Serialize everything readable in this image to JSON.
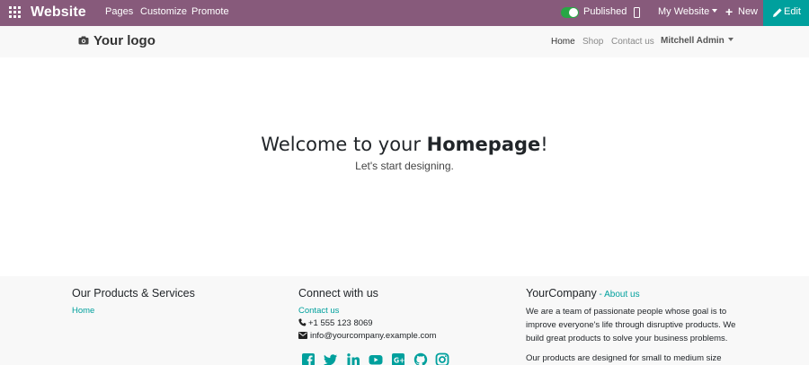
{
  "admin_bar": {
    "app_name": "Website",
    "menus": [
      "Pages",
      "Customize",
      "Promote"
    ],
    "published_label": "Published",
    "website_selector": "My Website",
    "new_label": "New",
    "edit_label": "Edit",
    "colors": {
      "bar": "#875a7b",
      "edit": "#00a09d",
      "toggle_on": "#28a745"
    }
  },
  "site_header": {
    "logo_text": "Your logo",
    "nav": [
      "Home",
      "Shop",
      "Contact us"
    ],
    "user": "Mitchell Admin"
  },
  "hero": {
    "title_prefix": "Welcome to your ",
    "title_bold": "Homepage",
    "title_suffix": "!",
    "subtitle": "Let's start designing."
  },
  "footer": {
    "col1": {
      "heading": "Our Products & Services",
      "links": [
        "Home"
      ]
    },
    "col2": {
      "heading": "Connect with us",
      "contact_link": "Contact us",
      "phone": "+1 555 123 8069",
      "email": "info@yourcompany.example.com",
      "social_icons": [
        "facebook-icon",
        "twitter-icon",
        "linkedin-icon",
        "youtube-icon",
        "google-plus-icon",
        "github-icon",
        "instagram-icon"
      ]
    },
    "col3": {
      "heading": "YourCompany",
      "about_sep": " - ",
      "about_link": "About us",
      "paragraph1": "We are a team of passionate people whose goal is to improve everyone's life through disruptive products. We build great products to solve your business problems.",
      "paragraph2": "Our products are designed for small to medium size"
    },
    "accent_color": "#00a09d"
  }
}
